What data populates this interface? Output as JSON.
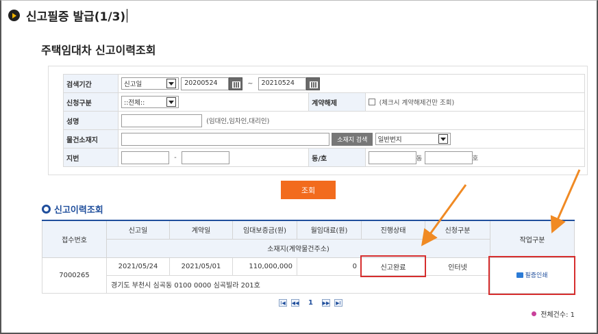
{
  "page": {
    "title": "신고필증 발급(1/3)"
  },
  "section": {
    "title": "주택임대차 신고이력조회"
  },
  "search": {
    "period_label": "검색기간",
    "period_type": "신고일",
    "date_from": "20200524",
    "tilde": "~",
    "date_to": "20210524",
    "apply_type_label": "신청구분",
    "apply_type_value": "::전체::",
    "cancel_label": "계약해제",
    "cancel_note": "(체크시 계약해제건만 조회)",
    "name_label": "성명",
    "name_note": "(임대인,임차인,대리인)",
    "address_label": "물건소재지",
    "address_search_button": "소재지 검색",
    "lot_type": "일반번지",
    "lot_label": "지번",
    "lot_dash": "-",
    "dong_ho_label": "동/호",
    "dong_suffix": "동",
    "ho_suffix": "호",
    "search_button": "조회"
  },
  "results": {
    "title": "신고이력조회",
    "headers": {
      "receipt_no": "접수번호",
      "report_date": "신고일",
      "contract_date": "계약일",
      "deposit": "임대보증금(원)",
      "monthly_rent": "월임대료(원)",
      "progress": "진행상태",
      "apply_type": "신청구분",
      "address": "소재지(계약물건주소)",
      "work_type": "작업구분"
    },
    "rows": [
      {
        "receipt_no": "7000265",
        "report_date": "2021/05/24",
        "contract_date": "2021/05/01",
        "deposit": "110,000,000",
        "monthly_rent": "0",
        "progress": "신고완료",
        "apply_type": "인터넷",
        "address": "경기도 부천시 심곡동 0100 0000 심곡빌라 201호",
        "action": "필증인쇄"
      }
    ]
  },
  "pagination": {
    "first": "I◀",
    "prev": "◀◀",
    "current": "1",
    "next": "▶▶",
    "last": "▶I"
  },
  "total": {
    "text": "전체건수: 1"
  },
  "colors": {
    "accent_orange": "#f26b1d",
    "highlight_red": "#d62d2d",
    "header_blue": "#1f4e9c"
  }
}
